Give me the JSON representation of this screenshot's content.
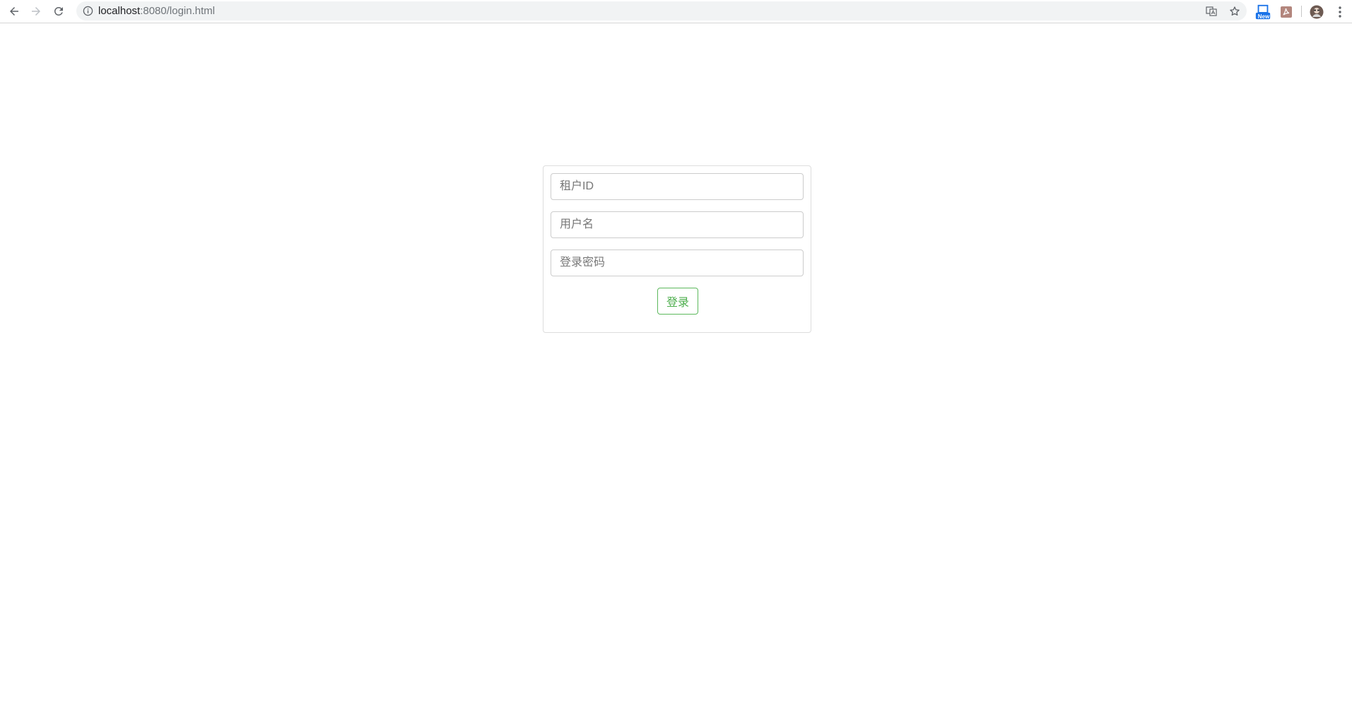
{
  "browser": {
    "url_host": "localhost",
    "url_rest": ":8080/login.html",
    "extension_badge": "New",
    "colors": {
      "toolbar_bg": "#ffffff",
      "omnibox_bg": "#f1f3f4",
      "badge_blue": "#1a73e8",
      "pdf_ext": "#b3867d"
    },
    "icons": [
      "back-arrow-icon",
      "forward-arrow-icon",
      "reload-icon",
      "info-icon",
      "translate-icon",
      "star-icon",
      "news-extension-icon",
      "pdf-extension-icon",
      "profile-avatar-icon",
      "kebab-menu-icon"
    ]
  },
  "login": {
    "tenant_placeholder": "租户ID",
    "tenant_value": "",
    "username_placeholder": "用户名",
    "username_value": "",
    "password_placeholder": "登录密码",
    "password_value": "",
    "submit_label": "登录",
    "colors": {
      "button_border": "#5cb85c",
      "button_text": "#4cae4c",
      "field_border": "#cccccc",
      "panel_border": "#dddddd"
    }
  }
}
